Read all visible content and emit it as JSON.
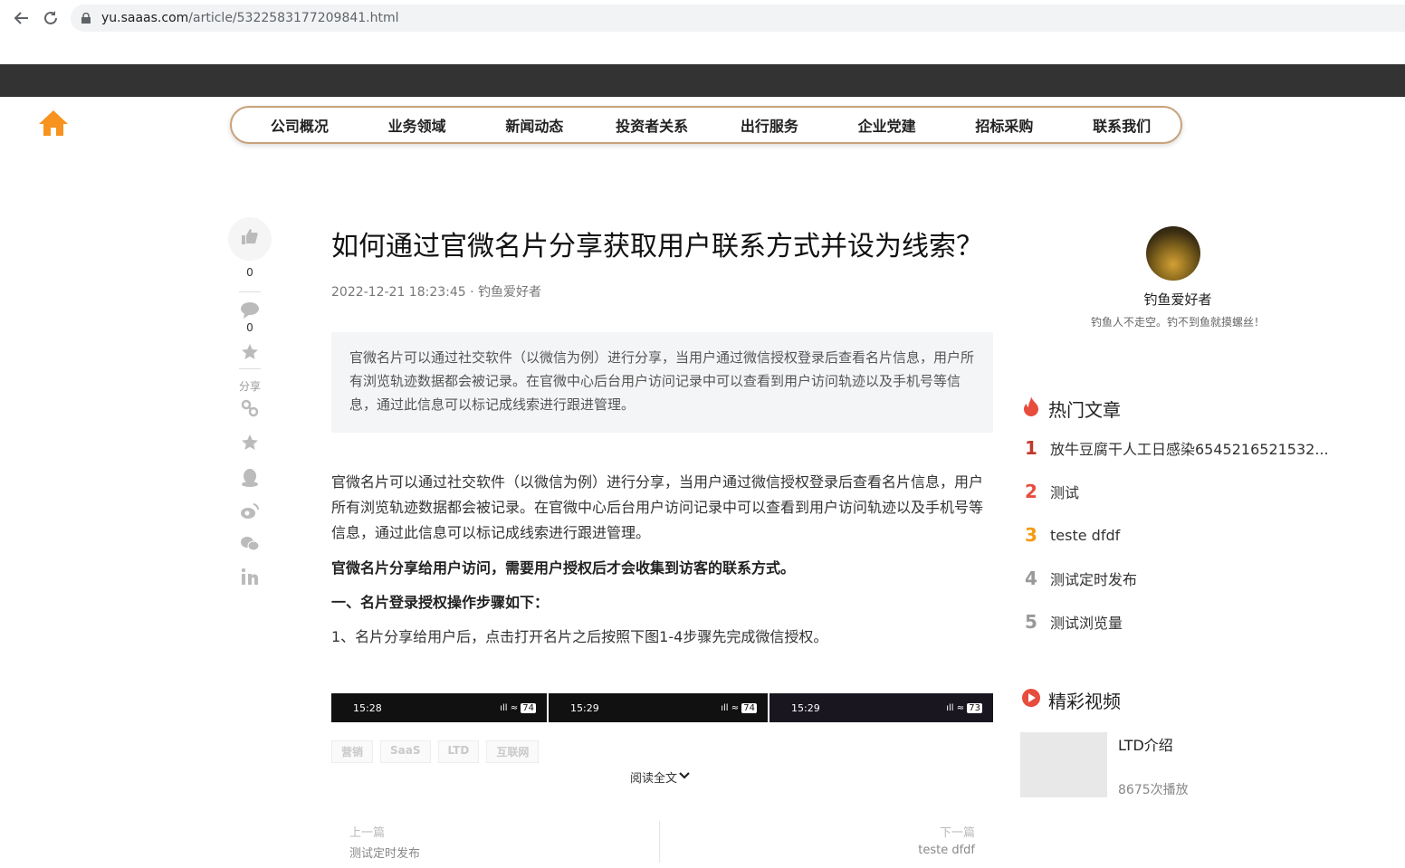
{
  "browser": {
    "url_host": "yu.saaas.com",
    "url_path": "/article/5322583177209841.html"
  },
  "nav": {
    "items": [
      "公司概况",
      "业务领域",
      "新闻动态",
      "投资者关系",
      "出行服务",
      "企业党建",
      "招标采购",
      "联系我们"
    ]
  },
  "rail": {
    "like_count": "0",
    "comment_count": "0",
    "share_label": "分享"
  },
  "article": {
    "title": "如何通过官微名片分享获取用户联系方式并设为线索？",
    "meta": "2022-12-21 18:23:45 · 钓鱼爱好者",
    "summary": "官微名片可以通过社交软件（以微信为例）进行分享，当用户通过微信授权登录后查看名片信息，用户所有浏览轨迹数据都会被记录。在官微中心后台用户访问记录中可以查看到用户访问轨迹以及手机号等信息，通过此信息可以标记成线索进行跟进管理。",
    "para1": "官微名片可以通过社交软件（以微信为例）进行分享，当用户通过微信授权登录后查看名片信息，用户所有浏览轨迹数据都会被记录。在官微中心后台用户访问记录中可以查看到用户访问轨迹以及手机号等信息，通过此信息可以标记成线索进行跟进管理。",
    "para2": "官微名片分享给用户访问，需要用户授权后才会收集到访客的联系方式。",
    "para3": "一、名片登录授权操作步骤如下：",
    "para4": "1、名片分享给用户后，点击打开名片之后按照下图1-4步骤先完成微信授权。",
    "screenshots": [
      {
        "time": "15:28",
        "battery": "74"
      },
      {
        "time": "15:29",
        "battery": "74"
      },
      {
        "time": "15:29",
        "battery": "73"
      }
    ],
    "tags": [
      "营销",
      "SaaS",
      "LTD",
      "互联网"
    ],
    "read_more": "阅读全文"
  },
  "pager": {
    "prev_label": "上一篇",
    "prev_title": "测试定时发布",
    "next_label": "下一篇",
    "next_title": "teste dfdf"
  },
  "sidebar": {
    "author_name": "钓鱼爱好者",
    "author_motto": "钓鱼人不走空。钓不到鱼就摸螺丝！",
    "hot_title": "热门文章",
    "hot_articles": [
      {
        "num": "1",
        "title": "放牛豆腐干人工日感染6545216521532..."
      },
      {
        "num": "2",
        "title": "测试"
      },
      {
        "num": "3",
        "title": "teste dfdf"
      },
      {
        "num": "4",
        "title": "测试定时发布"
      },
      {
        "num": "5",
        "title": "测试浏览量"
      }
    ],
    "video_title": "精彩视频",
    "video": {
      "title": "LTD介绍",
      "plays": "8675次播放"
    }
  },
  "colors": {
    "accent_orange": "#f7931e",
    "rank1": "#c0392b",
    "rank2": "#e74c3c",
    "rank3": "#f39c12",
    "rank_other": "#999999",
    "menu_border": "#c8a27a"
  }
}
